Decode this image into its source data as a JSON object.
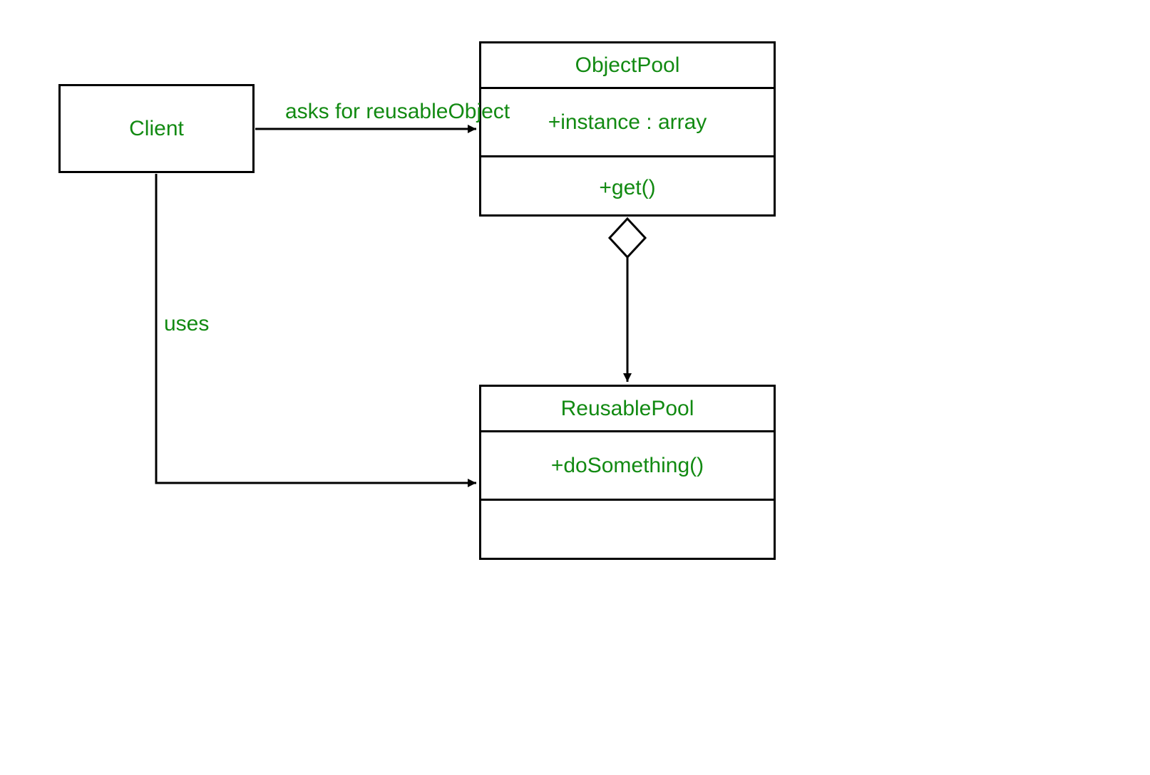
{
  "classes": {
    "client": {
      "name": "Client"
    },
    "objectPool": {
      "name": "ObjectPool",
      "attribute": "+instance : array",
      "method": "+get()"
    },
    "reusablePool": {
      "name": "ReusablePool",
      "method": "+doSomething()"
    }
  },
  "edges": {
    "clientToObjectPool": {
      "label": "asks for reusableObject"
    },
    "clientToReusablePool": {
      "label": "uses"
    }
  },
  "colors": {
    "text": "#128a12",
    "line": "#000000",
    "background": "#ffffff"
  }
}
